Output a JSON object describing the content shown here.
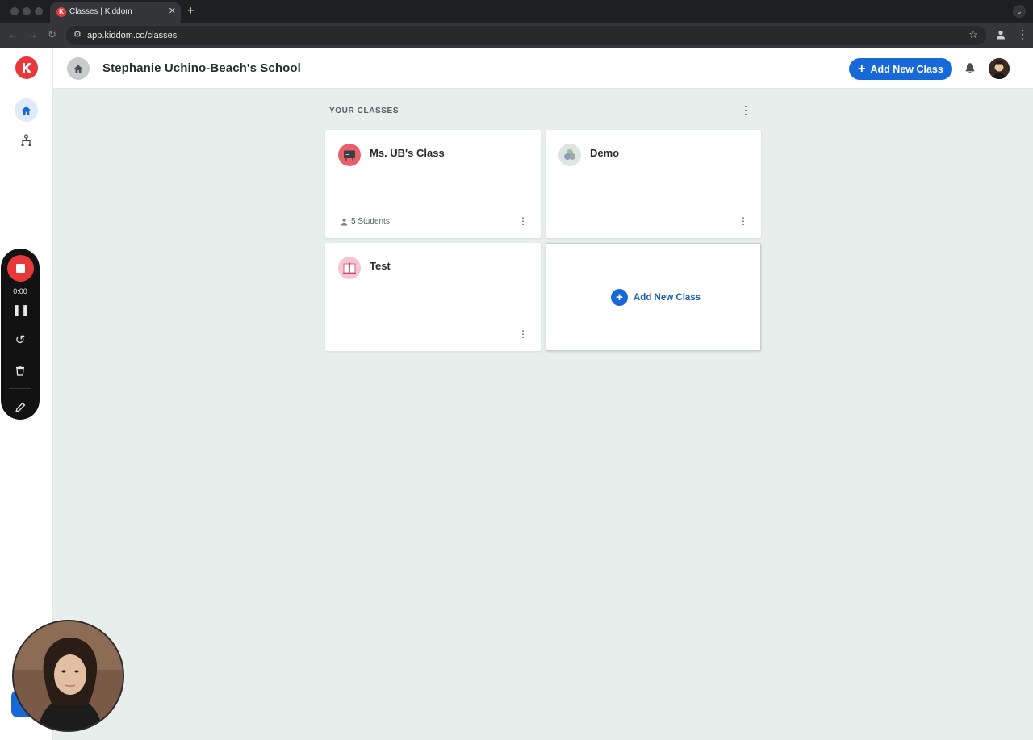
{
  "browser": {
    "tab_title": "Classes | Kiddom",
    "tab_favicon_letter": "K",
    "url": "app.kiddom.co/classes"
  },
  "sidebar": {
    "items": [
      {
        "name": "home",
        "icon": "home-icon",
        "active": true
      },
      {
        "name": "hierarchy",
        "icon": "hierarchy-icon",
        "active": false
      }
    ]
  },
  "header": {
    "school_name": "Stephanie Uchino-Beach's School",
    "add_class_label": "Add New Class"
  },
  "main": {
    "section_title": "YOUR CLASSES",
    "classes": [
      {
        "title": "Ms. UB's Class",
        "meta": "5 Students",
        "icon": "chalkboard-icon",
        "icon_color": "#e8606a"
      },
      {
        "title": "Demo",
        "meta": "",
        "icon": "circles-icon",
        "icon_color": "#dfe3e2"
      },
      {
        "title": "Test",
        "meta": "",
        "icon": "book-icon",
        "icon_color": "#f4c6d4"
      }
    ],
    "add_card_label": "Add New Class"
  },
  "recorder": {
    "time": "0:00"
  },
  "colors": {
    "brand_red": "#e8383b",
    "primary_blue": "#1769d9",
    "page_bg": "#e8eeec"
  }
}
